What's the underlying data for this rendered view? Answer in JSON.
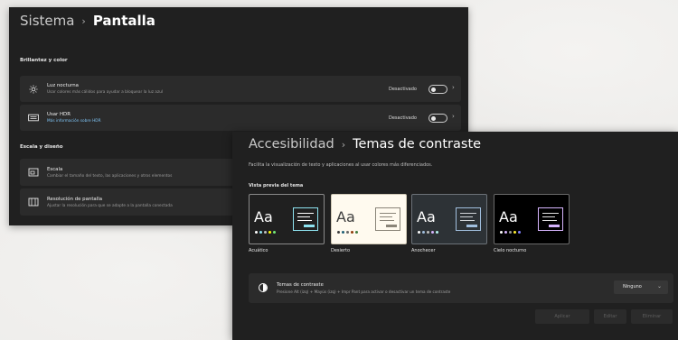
{
  "window_display": {
    "breadcrumb": {
      "parent": "Sistema",
      "separator": "›",
      "current": "Pantalla"
    },
    "sections": [
      {
        "title": "Brillantez y color",
        "cards": [
          {
            "icon": "sun-icon",
            "title": "Luz nocturna",
            "subtitle": "Usar colores más cálidos para ayudar a bloquear la luz azul",
            "state": "Desactivado",
            "chevron": "›"
          },
          {
            "icon": "hdr-icon",
            "title": "Usar HDR",
            "subtitle": "Más información sobre HDR",
            "state": "Desactivado",
            "chevron": "›"
          }
        ]
      },
      {
        "title": "Escala y diseño",
        "cards": [
          {
            "icon": "scale-icon",
            "title": "Escala",
            "subtitle": "Cambiar el tamaño del texto, las aplicaciones y otros elementos"
          },
          {
            "icon": "resolution-icon",
            "title": "Resolución de pantalla",
            "subtitle": "Ajustar la resolución para que se adapte a la pantalla conectada"
          }
        ]
      }
    ]
  },
  "window_contrast": {
    "breadcrumb": {
      "parent": "Accesibilidad",
      "separator": "›",
      "current": "Temas de contraste"
    },
    "description": "Facilita la visualización de texto y aplicaciones al usar colores más diferenciados.",
    "preview_title": "Vista previa del tema",
    "themes": [
      {
        "name": "Acuático",
        "sample": "Aa",
        "bg": "#202020",
        "fg": "#ffffff",
        "accent": "#8ee3f0",
        "selected": false
      },
      {
        "name": "Desierto",
        "sample": "Aa",
        "bg": "#fffaef",
        "fg": "#3d3d3d",
        "accent": "#1c5e75",
        "selected": true
      },
      {
        "name": "Anochecer",
        "sample": "Aa",
        "bg": "#2d3236",
        "fg": "#ffffff",
        "accent": "#a1bfde",
        "selected": false
      },
      {
        "name": "Cielo nocturno",
        "sample": "Aa",
        "bg": "#000000",
        "fg": "#ffffff",
        "accent": "#d6b4fd",
        "selected": false
      }
    ],
    "setting": {
      "icon": "contrast-icon",
      "title": "Temas de contraste",
      "subtitle": "Presione Alt (izq) + Mayús (izq) + Impr Pant para activar o desactivar un tema de contraste",
      "value": "Ninguno",
      "caret": "⌄"
    },
    "buttons": {
      "apply": "Aplicar",
      "cancel": "Editar",
      "edit": "Eliminar"
    }
  }
}
